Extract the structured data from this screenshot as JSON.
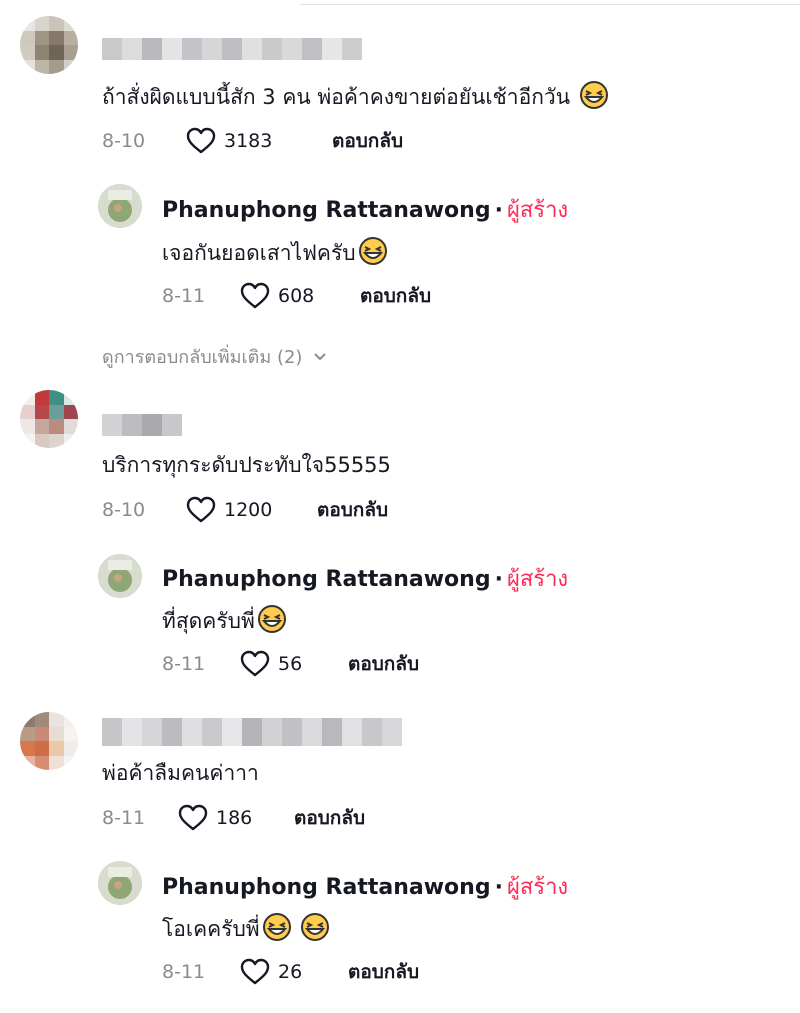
{
  "comments": [
    {
      "text": "ถ้าสั่งผิดแบบนี้สัก 3 คน พ่อค้าคงขายต่อยันเช้าอีกวัน",
      "date": "8-10",
      "likes": "3183",
      "reply_label": "ตอบกลับ",
      "reply": {
        "author": "Phanuphong Rattanawong",
        "dot": "·",
        "badge": "ผู้สร้าง",
        "text": "เจอกันยอดเสาไฟครับ",
        "date": "8-11",
        "likes": "608",
        "reply_label": "ตอบกลับ"
      },
      "more_replies": "ดูการตอบกลับเพิ่มเติม (2)"
    },
    {
      "text": "บริการทุกระดับประทับใจ55555",
      "date": "8-10",
      "likes": "1200",
      "reply_label": "ตอบกลับ",
      "reply": {
        "author": "Phanuphong Rattanawong",
        "dot": "·",
        "badge": "ผู้สร้าง",
        "text": "ที่สุดครับพี่",
        "date": "8-11",
        "likes": "56",
        "reply_label": "ตอบกลับ"
      }
    },
    {
      "text": "พ่อค้าลืมคนค่าาา",
      "date": "8-11",
      "likes": "186",
      "reply_label": "ตอบกลับ",
      "reply": {
        "author": "Phanuphong Rattanawong",
        "dot": "·",
        "badge": "ผู้สร้าง",
        "text": "โอเคครับพี่",
        "date": "8-11",
        "likes": "26",
        "reply_label": "ตอบกลับ"
      }
    }
  ],
  "icons": {
    "like": "heart-outline-icon",
    "emoji": "grinning-squinting-emoji",
    "chevron": "chevron-down-icon"
  },
  "colors": {
    "creator_badge": "#fe2c55",
    "muted": "#8a8b91",
    "text": "#161823"
  }
}
